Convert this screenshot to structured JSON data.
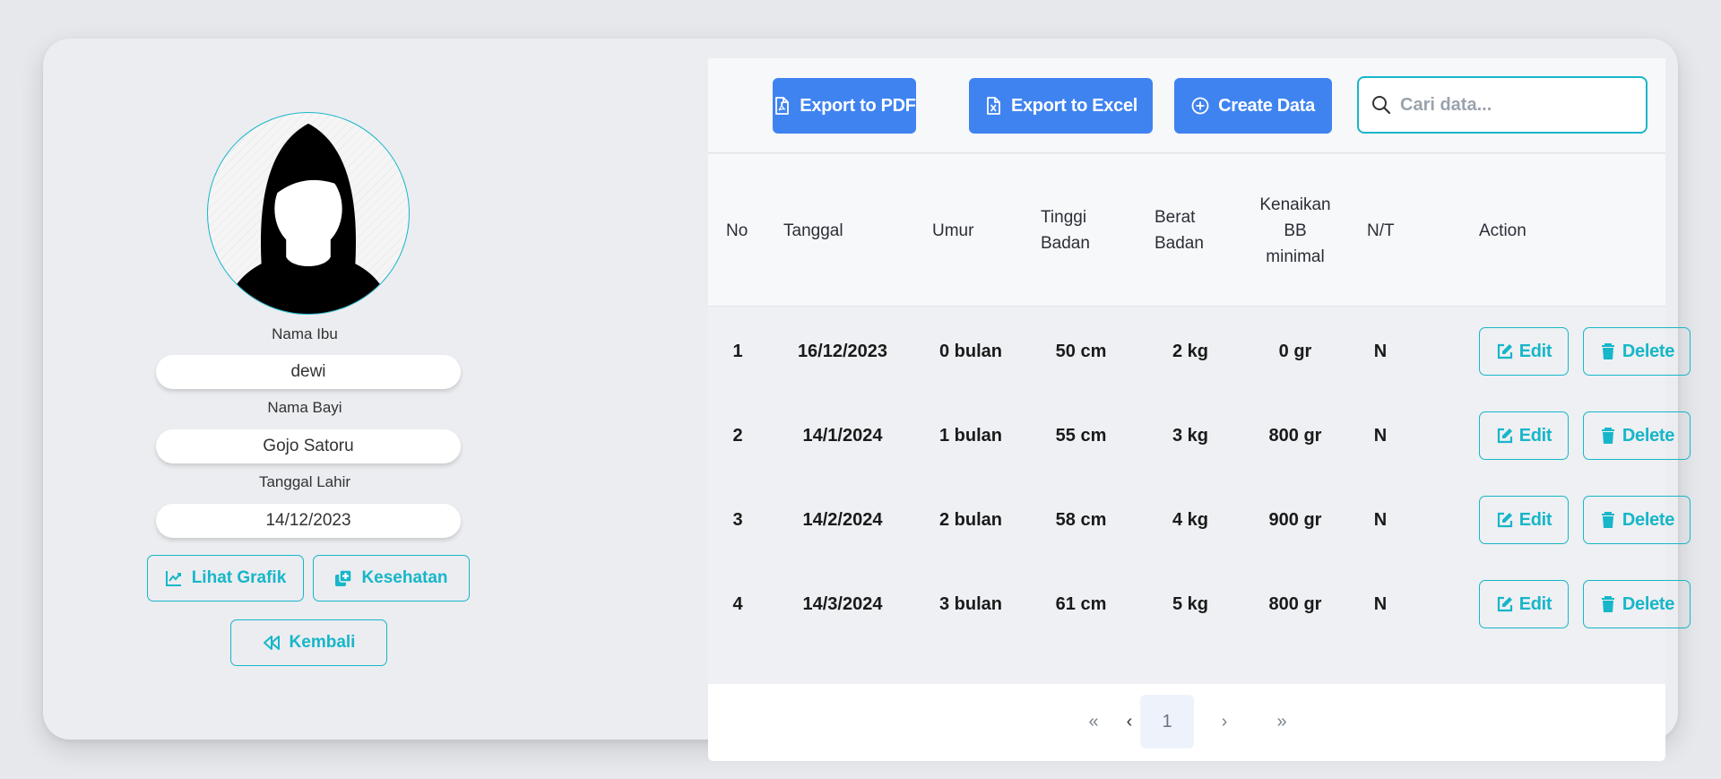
{
  "profile": {
    "mother_label": "Nama Ibu",
    "mother_value": "dewi",
    "baby_label": "Nama Bayi",
    "baby_value": "Gojo Satoru",
    "dob_label": "Tanggal Lahir",
    "dob_value": "14/12/2023",
    "chart_button": "Lihat Grafik",
    "health_button": "Kesehatan",
    "back_button": "Kembali"
  },
  "toolbar": {
    "export_pdf": "Export to PDF",
    "export_excel": "Export to Excel",
    "create": "Create Data",
    "search_placeholder": "Cari data..."
  },
  "table": {
    "headers": {
      "no": "No",
      "date": "Tanggal",
      "age": "Umur",
      "height_1": "Tinggi",
      "height_2": "Badan",
      "weight_1": "Berat",
      "weight_2": "Badan",
      "gain_1": "Kenaikan",
      "gain_2": "BB",
      "gain_3": "minimal",
      "nt": "N/T",
      "action": "Action"
    },
    "edit_label": "Edit",
    "delete_label": "Delete",
    "rows": [
      {
        "no": "1",
        "date": "16/12/2023",
        "age": "0 bulan",
        "height": "50 cm",
        "weight": "2 kg",
        "gain": "0 gr",
        "nt": "N"
      },
      {
        "no": "2",
        "date": "14/1/2024",
        "age": "1 bulan",
        "height": "55 cm",
        "weight": "3 kg",
        "gain": "800 gr",
        "nt": "N"
      },
      {
        "no": "3",
        "date": "14/2/2024",
        "age": "2 bulan",
        "height": "58 cm",
        "weight": "4 kg",
        "gain": "900 gr",
        "nt": "N"
      },
      {
        "no": "4",
        "date": "14/3/2024",
        "age": "3 bulan",
        "height": "61 cm",
        "weight": "5 kg",
        "gain": "800 gr",
        "nt": "N"
      }
    ]
  },
  "pagination": {
    "first": "«",
    "prev": "‹",
    "current": "1",
    "next": "›",
    "last": "»"
  },
  "colors": {
    "accent": "#17b6c9",
    "primary": "#3f83f0",
    "page_bg": "#e6e8ec",
    "card_bg": "#ebedf0"
  }
}
